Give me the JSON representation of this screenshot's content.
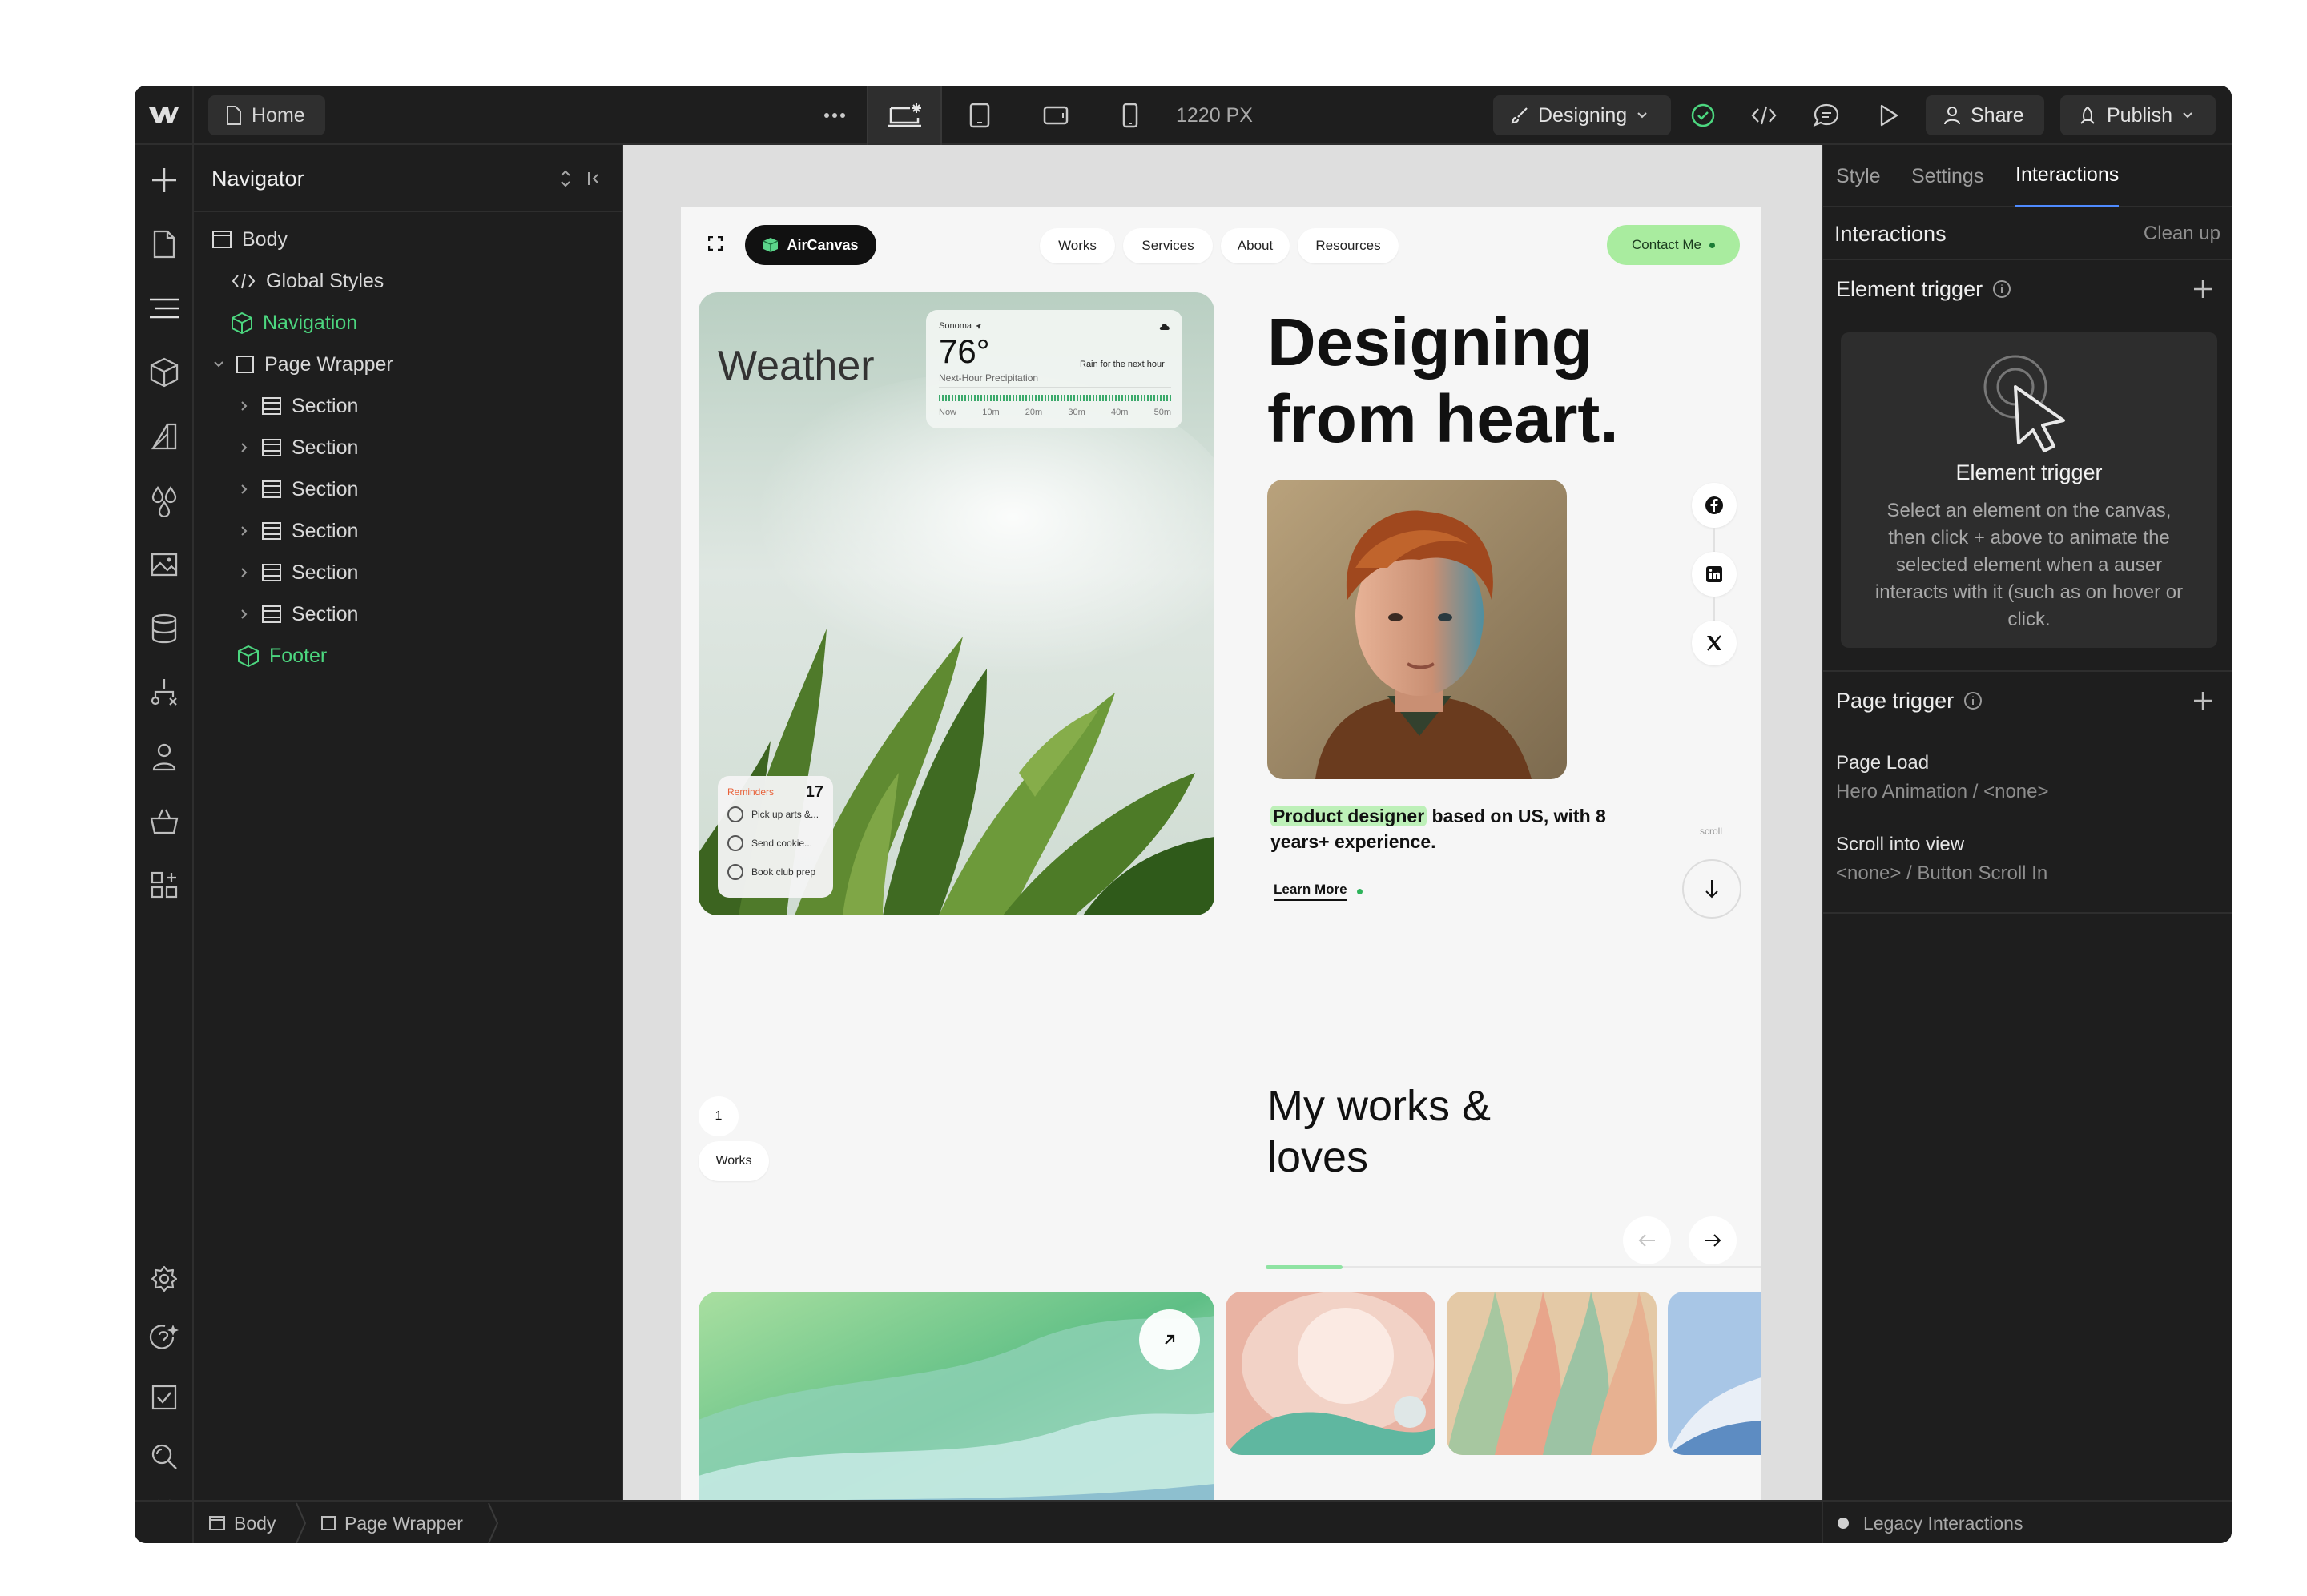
{
  "topbar": {
    "home_label": "Home",
    "canvas_width": "1220 PX",
    "mode_label": "Designing",
    "share_label": "Share",
    "publish_label": "Publish"
  },
  "navigator": {
    "title": "Navigator",
    "items": [
      {
        "label": "Body"
      },
      {
        "label": "Global Styles"
      },
      {
        "label": "Navigation"
      },
      {
        "label": "Page Wrapper"
      },
      {
        "label": "Section"
      },
      {
        "label": "Section"
      },
      {
        "label": "Section"
      },
      {
        "label": "Section"
      },
      {
        "label": "Section"
      },
      {
        "label": "Section"
      },
      {
        "label": "Footer"
      }
    ]
  },
  "site": {
    "brand": "AirCanvas",
    "nav": [
      "Works",
      "Services",
      "About",
      "Resources"
    ],
    "contact": "Contact Me",
    "weather": {
      "title": "Weather",
      "location": "Sonoma",
      "temp": "76°",
      "rain_note": "Rain for the next hour",
      "precip_label": "Next-Hour Precipitation",
      "times": [
        "Now",
        "10m",
        "20m",
        "30m",
        "40m",
        "50m"
      ]
    },
    "reminders": {
      "title": "Reminders",
      "count": "17",
      "items": [
        "Pick up arts &...",
        "Send cookie...",
        "Book club prep"
      ]
    },
    "hero": {
      "line1": "Designing",
      "line2": "from heart.",
      "highlight": "Product designer",
      "desc1": " based on US, with 8",
      "desc2": "years+ experience.",
      "learn_more": "Learn More",
      "scroll": "scroll"
    },
    "works": {
      "number": "1",
      "tag": "Works",
      "title1": "My works &",
      "title2": "loves"
    }
  },
  "right_panel": {
    "tabs": [
      "Style",
      "Settings",
      "Interactions"
    ],
    "section_title": "Interactions",
    "clean_up": "Clean up",
    "element_trigger": {
      "title": "Element trigger",
      "card_title": "Element trigger",
      "card_lines": [
        "Select an element on the canvas,",
        "then click + above to animate the",
        "selected element when a auser",
        "interacts with it (such as on hover or",
        "click."
      ]
    },
    "page_trigger": {
      "title": "Page trigger",
      "items": [
        {
          "name": "Page Load",
          "value": "Hero Animation / <none>"
        },
        {
          "name": "Scroll into view",
          "value": "<none> / Button Scroll In"
        }
      ]
    }
  },
  "bottombar": {
    "crumbs": [
      "Body",
      "Page Wrapper"
    ],
    "legacy": "Legacy Interactions"
  },
  "colors": {
    "accent_green": "#4cd67f",
    "highlight_green": "#bdf0b8",
    "dark_bg": "#1e1e1e"
  }
}
